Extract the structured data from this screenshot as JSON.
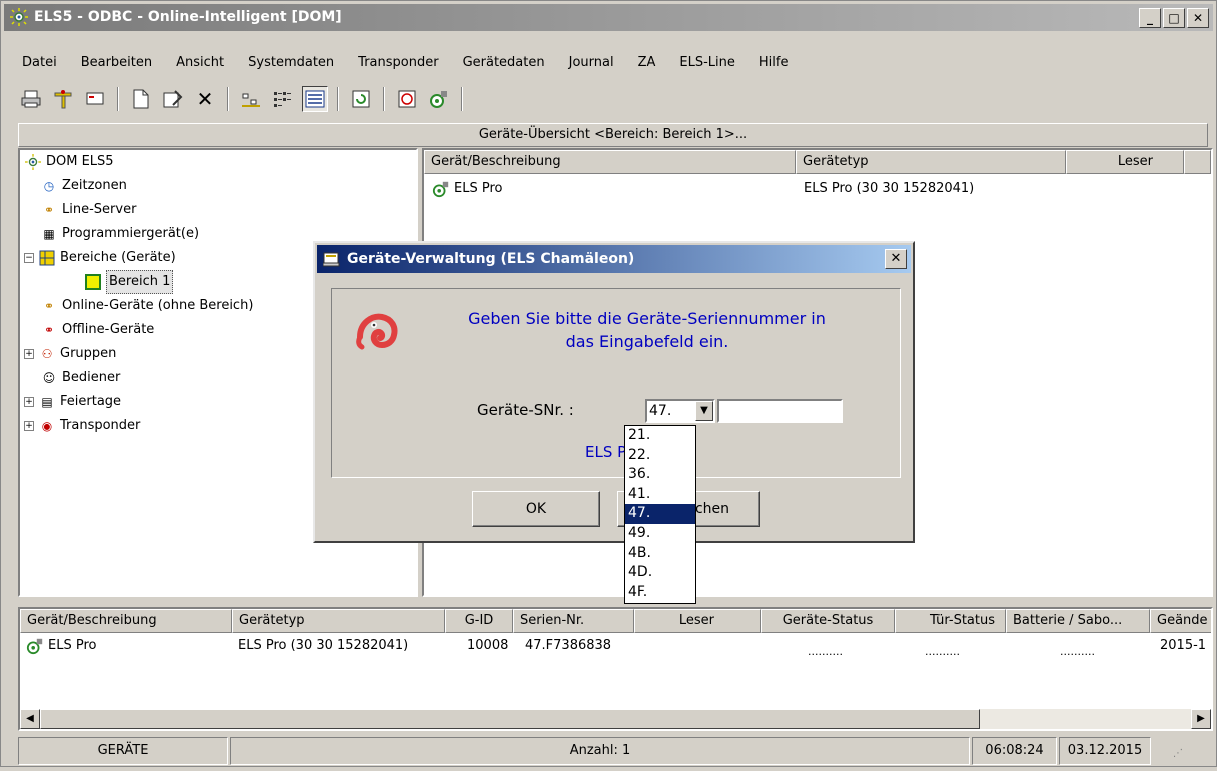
{
  "window": {
    "title": "ELS5 - ODBC - Online-Intelligent [DOM]",
    "minimize": "_",
    "maximize": "□",
    "close": "✕"
  },
  "menu": [
    "Datei",
    "Bearbeiten",
    "Ansicht",
    "Systemdaten",
    "Transponder",
    "Gerätedaten",
    "Journal",
    "ZA",
    "ELS-Line",
    "Hilfe"
  ],
  "header_bar": "Geräte-Übersicht <Bereich: Bereich 1>...",
  "tree": {
    "root": "DOM ELS5",
    "items": [
      "Zeitzonen",
      "Line-Server",
      "Programmiergerät(e)",
      "Bereiche (Geräte)",
      "Bereich 1",
      "Online-Geräte (ohne Bereich)",
      "Offline-Geräte",
      "Gruppen",
      "Bediener",
      "Feiertage",
      "Transponder"
    ]
  },
  "device_list": {
    "columns": [
      "Gerät/Beschreibung",
      "Gerätetyp",
      "Leser"
    ],
    "rows": [
      {
        "name": "ELS Pro",
        "type": "ELS Pro (30 30 15282041)"
      }
    ]
  },
  "bottom_table": {
    "columns": [
      "Gerät/Beschreibung",
      "Gerätetyp",
      "G-ID",
      "Serien-Nr.",
      "Leser",
      "Geräte-Status",
      "Tür-Status",
      "Batterie / Sabo...",
      "Geände"
    ],
    "rows": [
      {
        "name": "ELS Pro",
        "type": "ELS Pro (30 30 15282041)",
        "gid": "10008",
        "serial": "47.F7386838",
        "reader": "",
        "device_status": "..........",
        "door_status": "..........",
        "battery": "..........",
        "changed": "2015-1"
      }
    ]
  },
  "status_bar": {
    "mode": "GERÄTE",
    "count": "Anzahl: 1",
    "time": "06:08:24",
    "date": "03.12.2015"
  },
  "dialog": {
    "title": "Geräte-Verwaltung (ELS Chamäleon)",
    "close": "✕",
    "message_line1": "Geben Sie bitte die Geräte-Seriennummer in",
    "message_line2": "das Eingabefeld ein.",
    "serial_label": "Geräte-SNr. :",
    "serial_prefix": "47.",
    "serial_value": "",
    "device_hint": "ELS P",
    "ok_label": "OK",
    "cancel_label_visible": "chen"
  },
  "serial_prefix_options": [
    "21.",
    "22.",
    "36.",
    "41.",
    "47.",
    "49.",
    "4B.",
    "4D.",
    "4F."
  ],
  "serial_prefix_selected": "47."
}
